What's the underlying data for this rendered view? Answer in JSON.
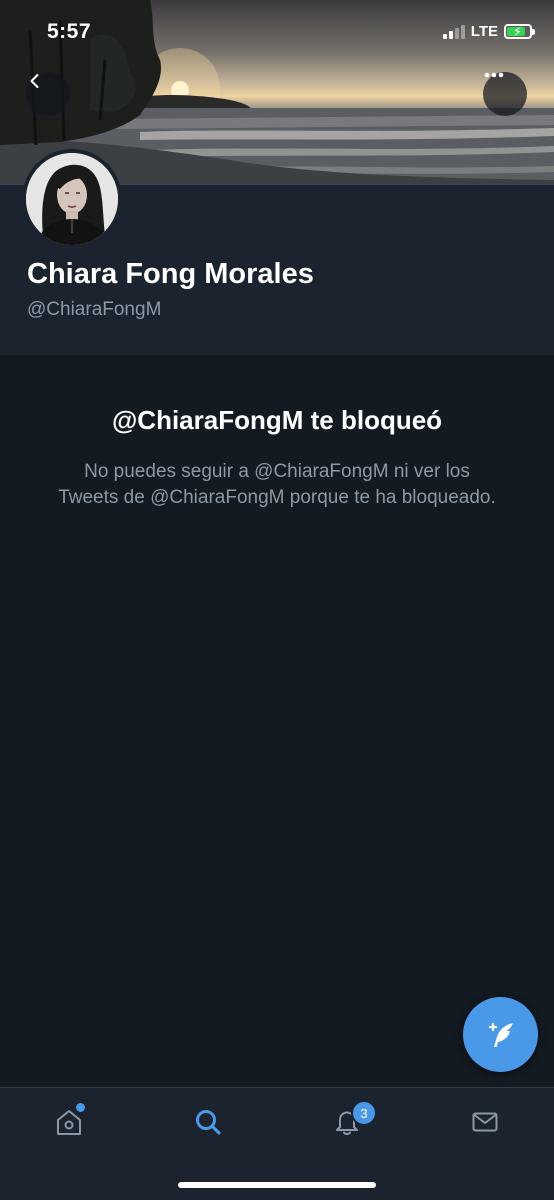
{
  "status_bar": {
    "time": "5:57",
    "network": "LTE",
    "battery_color": "#3ad157"
  },
  "header": {
    "back_icon": "chevron-left-icon",
    "more_icon": "ellipsis-icon",
    "banner": "sunset-beach-photo"
  },
  "profile": {
    "display_name": "Chiara Fong Morales",
    "handle": "@ChiaraFongM",
    "avatar": "profile-photo"
  },
  "blocked": {
    "title": "@ChiaraFongM te bloqueó",
    "message": "No puedes seguir a @ChiaraFongM ni ver los Tweets de @ChiaraFongM porque te ha bloqueado."
  },
  "fab": {
    "icon": "compose-tweet-icon",
    "color": "#4a99e9"
  },
  "tab_bar": {
    "items": [
      {
        "name": "home",
        "icon": "home-icon",
        "has_dot": true
      },
      {
        "name": "search",
        "icon": "search-icon",
        "active": true
      },
      {
        "name": "notifications",
        "icon": "bell-icon",
        "badge": "3"
      },
      {
        "name": "messages",
        "icon": "envelope-icon"
      }
    ]
  },
  "colors": {
    "background": "#141a22",
    "surface": "#1b232f",
    "accent": "#4a99e9",
    "secondary_text": "#8b98a5"
  }
}
